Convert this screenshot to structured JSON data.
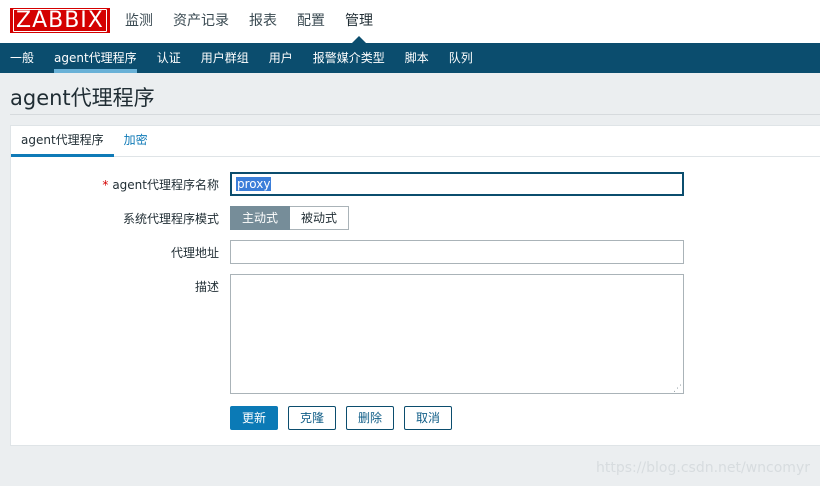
{
  "app": {
    "logo": "ZABBIX"
  },
  "main_nav": [
    {
      "label": "监测"
    },
    {
      "label": "资产记录"
    },
    {
      "label": "报表"
    },
    {
      "label": "配置"
    },
    {
      "label": "管理"
    }
  ],
  "sub_nav": [
    {
      "label": "一般"
    },
    {
      "label": "agent代理程序"
    },
    {
      "label": "认证"
    },
    {
      "label": "用户群组"
    },
    {
      "label": "用户"
    },
    {
      "label": "报警媒介类型"
    },
    {
      "label": "脚本"
    },
    {
      "label": "队列"
    }
  ],
  "page": {
    "title": "agent代理程序"
  },
  "tabs": [
    {
      "label": "agent代理程序"
    },
    {
      "label": "加密"
    }
  ],
  "form": {
    "name_required_mark": "*",
    "name_label": "agent代理程序名称",
    "name_value": "proxy",
    "mode_label": "系统代理程序模式",
    "mode_options": [
      {
        "label": "主动式",
        "selected": true
      },
      {
        "label": "被动式",
        "selected": false
      }
    ],
    "address_label": "代理地址",
    "address_value": "",
    "description_label": "描述",
    "description_value": ""
  },
  "buttons": {
    "update": "更新",
    "clone": "克隆",
    "delete": "删除",
    "cancel": "取消"
  },
  "watermark": "https://blog.csdn.net/wncomyr",
  "colors": {
    "brand_red": "#d40000",
    "nav_dark": "#0b4d6e",
    "accent_blue": "#0f7ab7"
  }
}
